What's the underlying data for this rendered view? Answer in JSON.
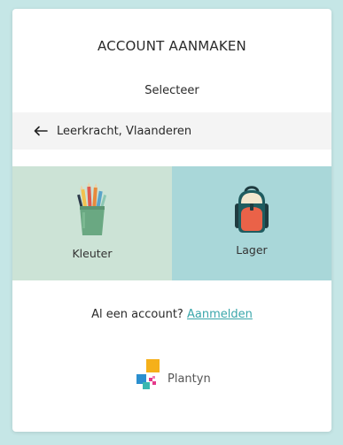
{
  "header": {
    "title": "ACCOUNT AANMAKEN",
    "subtitle": "Selecteer"
  },
  "back": {
    "label": "Leerkracht, Vlaanderen",
    "icon": "arrow-left-icon"
  },
  "options": [
    {
      "label": "Kleuter",
      "icon": "pencil-cup-icon",
      "background": "#cce3d6"
    },
    {
      "label": "Lager",
      "icon": "backpack-icon",
      "background": "#a9d7d9"
    }
  ],
  "login": {
    "prompt": "Al een account?",
    "link_label": "Aanmelden"
  },
  "brand": {
    "name": "Plantyn",
    "logo_icon": "plantyn-logo-icon"
  },
  "colors": {
    "page_background": "#c5e6e6",
    "accent_link": "#3aa7ab"
  }
}
